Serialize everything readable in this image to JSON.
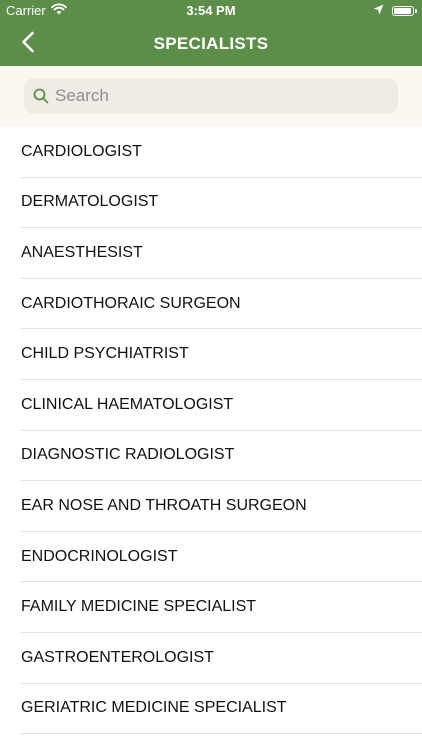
{
  "status_bar": {
    "carrier": "Carrier",
    "time": "3:54 PM",
    "battery_level": 0.95
  },
  "nav": {
    "title": "SPECIALISTS",
    "back_icon": "chevron-left-icon"
  },
  "search": {
    "placeholder": "Search",
    "value": ""
  },
  "specialists": [
    "CARDIOLOGIST",
    "DERMATOLOGIST",
    "ANAESTHESIST",
    "CARDIOTHORAIC SURGEON",
    "CHILD PSYCHIATRIST",
    "CLINICAL HAEMATOLOGIST",
    "DIAGNOSTIC RADIOLOGIST",
    "EAR NOSE AND THROATH SURGEON",
    "ENDOCRINOLOGIST",
    "FAMILY MEDICINE SPECIALIST",
    "GASTROENTEROLOGIST",
    "GERIATRIC MEDICINE SPECIALIST"
  ],
  "colors": {
    "header_green": "#5d8e49",
    "search_background": "#fbf7f1",
    "search_field": "#efece6"
  }
}
